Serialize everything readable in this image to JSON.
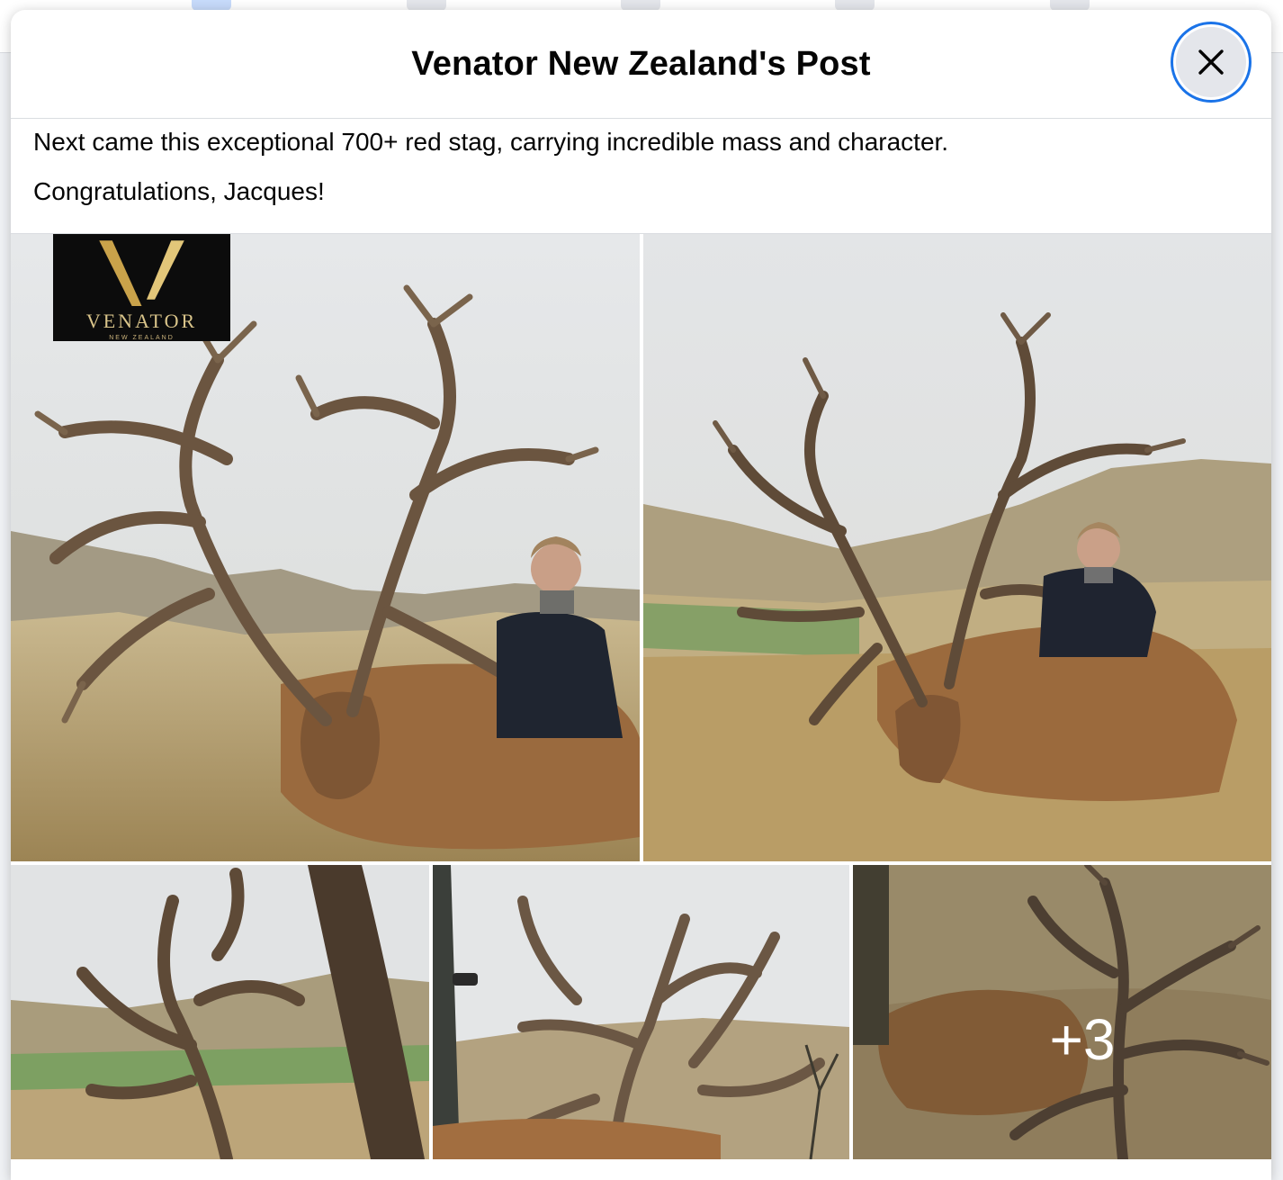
{
  "modal": {
    "title": "Venator New Zealand's Post",
    "close_icon": "close-icon"
  },
  "post": {
    "paragraphs": [
      "Next came this exceptional 700+ red stag, carrying incredible mass and character.",
      "Congratulations, Jacques!"
    ]
  },
  "photos": {
    "logo": {
      "name": "VENATOR",
      "sub": "NEW ZEALAND"
    },
    "items": [
      {
        "alt": "Hunter with trophy red stag, photo 1"
      },
      {
        "alt": "Hunter with trophy red stag, photo 2"
      },
      {
        "alt": "Close-up of antlers, photo 3"
      },
      {
        "alt": "Close-up of antlers with person, photo 4"
      },
      {
        "alt": "Stag lying in grass, photo 5"
      }
    ],
    "more_count": "+3"
  },
  "colors": {
    "accent_focus": "#1a73e8",
    "close_bg": "#e4e6eb",
    "logo_gold": "#d9c48a"
  }
}
